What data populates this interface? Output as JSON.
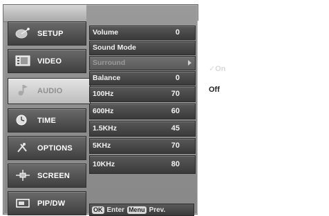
{
  "sidebar": {
    "items": [
      {
        "label": "SETUP",
        "icon": "satellite-dish-icon"
      },
      {
        "label": "VIDEO",
        "icon": "film-icon"
      },
      {
        "label": "AUDIO",
        "icon": "music-note-icon"
      },
      {
        "label": "TIME",
        "icon": "clock-icon"
      },
      {
        "label": "OPTIONS",
        "icon": "tools-icon"
      },
      {
        "label": "SCREEN",
        "icon": "screen-move-icon"
      },
      {
        "label": "PIP/DW",
        "icon": "pip-icon"
      }
    ],
    "active_index": 2
  },
  "settings": {
    "volume": {
      "label": "Volume",
      "value": "0"
    },
    "sound_mode": {
      "label": "Sound Mode"
    },
    "surround": {
      "label": "Surround"
    },
    "balance": {
      "label": "Balance",
      "value": "0"
    },
    "eq": [
      {
        "label": "100Hz",
        "value": "70"
      },
      {
        "label": "600Hz",
        "value": "60"
      },
      {
        "label": "1.5KHz",
        "value": "45"
      },
      {
        "label": "5KHz",
        "value": "70"
      },
      {
        "label": "10KHz",
        "value": "80"
      }
    ]
  },
  "footer": {
    "ok_key": "OK",
    "enter_label": "Enter",
    "menu_key": "Menu",
    "prev_label": "Prev."
  },
  "submenu": {
    "on_label": "✓On",
    "off_label": "Off"
  },
  "colors": {
    "panel": "#8f8f8f",
    "row_dark": "#3a3a3a",
    "active_tab": "#d0d0d0"
  }
}
